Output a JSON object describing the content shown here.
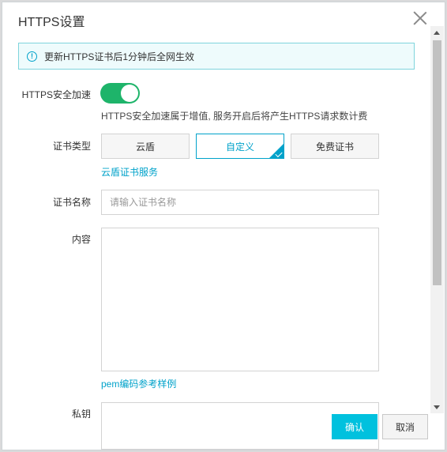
{
  "dialog": {
    "title": "HTTPS设置",
    "close_icon": "close-icon"
  },
  "notice": {
    "icon": "info-icon",
    "text": "更新HTTPS证书后1分钟后全网生效"
  },
  "https_accel": {
    "label": "HTTPS安全加速",
    "enabled": true,
    "hint": "HTTPS安全加速属于增值, 服务开启后将产生HTTPS请求数计费"
  },
  "cert_type": {
    "label": "证书类型",
    "options": [
      "云盾",
      "自定义",
      "免费证书"
    ],
    "selected": "自定义",
    "link": "云盾证书服务"
  },
  "cert_name": {
    "label": "证书名称",
    "placeholder": "请输入证书名称",
    "value": ""
  },
  "content": {
    "label": "内容",
    "link": "pem编码参考样例"
  },
  "private_key": {
    "label": "私钥"
  },
  "buttons": {
    "ok": "确认",
    "cancel": "取消"
  },
  "colors": {
    "accent": "#00a2ca",
    "primary_button": "#00c1de",
    "toggle_on": "#1eb46a",
    "notice_bg": "#eefbfc"
  }
}
